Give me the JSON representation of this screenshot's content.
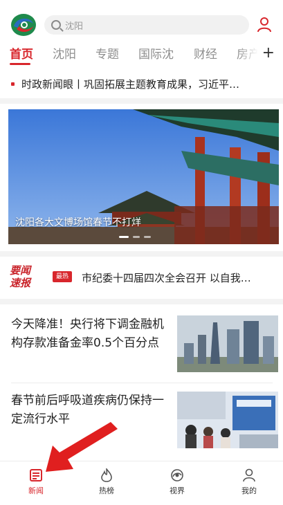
{
  "header": {
    "search_placeholder": "沈阳",
    "icons": {
      "logo": "app-logo",
      "search": "search-icon",
      "user": "user-icon"
    }
  },
  "tabs": [
    "首页",
    "沈阳",
    "专题",
    "国际沈",
    "财经",
    "房产"
  ],
  "active_tab": 0,
  "ticker": {
    "text": "时政新闻眼丨巩固拓展主题教育成果，习近平…"
  },
  "banner": {
    "caption": "沈阳各大文博场馆春节不打烊",
    "slides": 3,
    "active_slide": 0
  },
  "key_news": {
    "logo_line1": "要闻",
    "logo_line2": "速报",
    "badge": "最热",
    "text": "市纪委十四届四次全会召开 以自我…"
  },
  "news": [
    {
      "title": "今天降准！央行将下调金融机构存款准备金率0.5个百分点",
      "thumb": "city-skyline-image"
    },
    {
      "title": "春节前后呼吸道疾病仍保持一定流行水平",
      "thumb": "hospital-hall-image"
    }
  ],
  "bottom_nav": [
    {
      "label": "新闻",
      "icon": "news-icon"
    },
    {
      "label": "热榜",
      "icon": "flame-icon"
    },
    {
      "label": "视界",
      "icon": "vision-icon"
    },
    {
      "label": "我的",
      "icon": "profile-icon"
    }
  ],
  "active_nav": 0,
  "colors": {
    "accent": "#d8262c",
    "muted": "#8e8e8e"
  }
}
